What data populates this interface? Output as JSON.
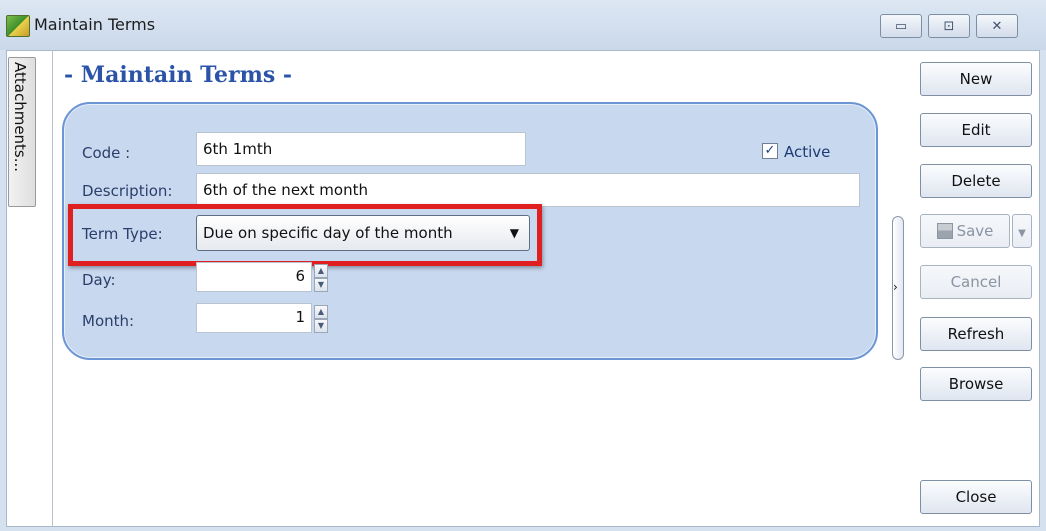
{
  "window": {
    "title": "Maintain Terms",
    "minimize_glyph": "▭",
    "maximize_glyph": "⊡",
    "close_glyph": "✕"
  },
  "side_tab": {
    "label": "Attachments..."
  },
  "form": {
    "heading": "- Maintain Terms -",
    "code_label": "Code :",
    "code_value": "6th 1mth",
    "active_label": "Active",
    "active_checked": true,
    "description_label": "Description:",
    "description_value": "6th of the next month",
    "term_type_label": "Term Type:",
    "term_type_value": "Due on specific day of the month",
    "day_label": "Day:",
    "day_value": "6",
    "month_label": "Month:",
    "month_value": "1"
  },
  "buttons": {
    "new": "New",
    "edit": "Edit",
    "delete": "Delete",
    "save": "Save",
    "cancel": "Cancel",
    "refresh": "Refresh",
    "browse": "Browse",
    "close": "Close"
  },
  "colors": {
    "heading": "#2b54a8",
    "panel_bg": "#c8d8ef",
    "panel_border": "#6c95d4",
    "highlight": "#e02020"
  }
}
